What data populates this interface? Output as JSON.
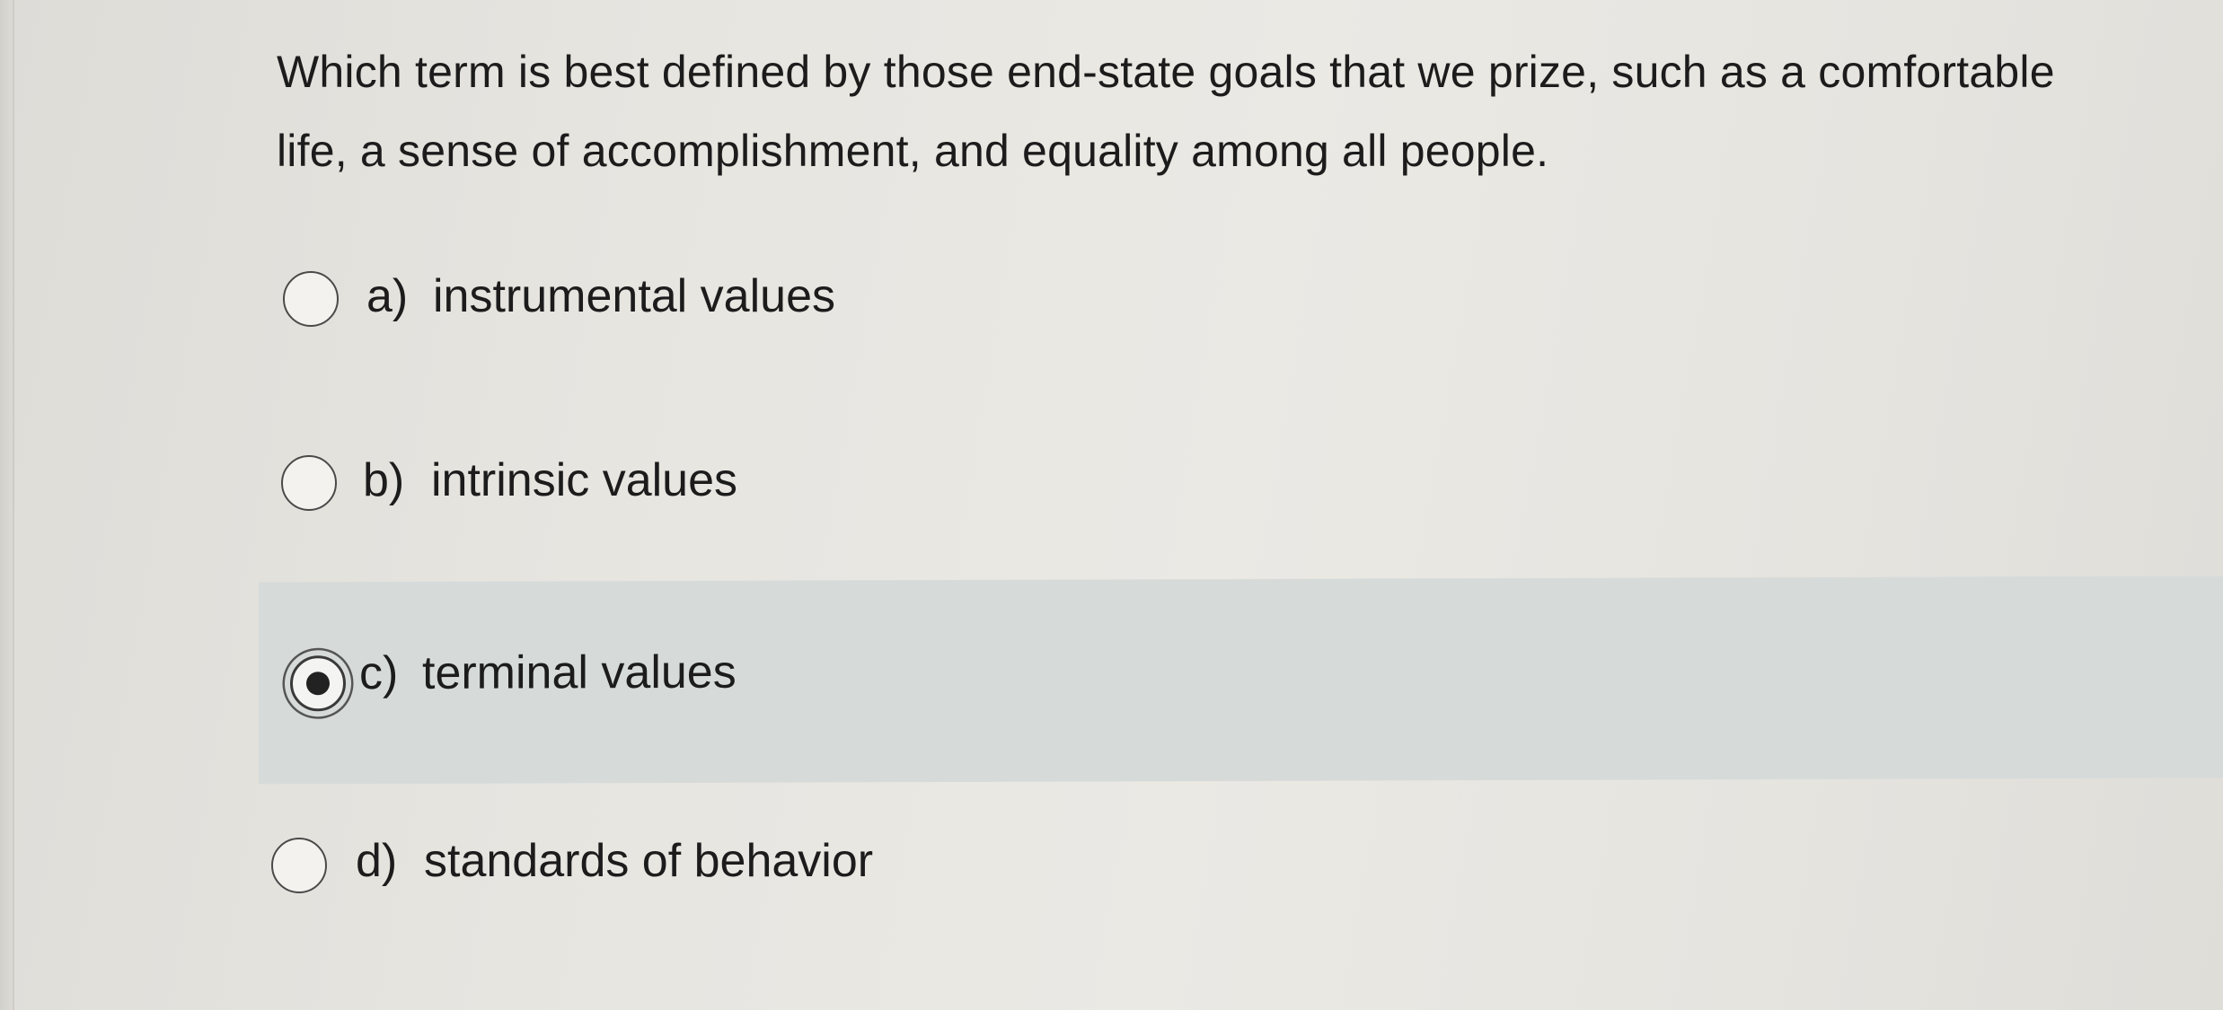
{
  "question": {
    "text": "Which term is best defined by those end-state goals that we prize, such as a comfortable life, a sense of accomplishment, and equality among all people."
  },
  "options": [
    {
      "letter": "a)",
      "text": "instrumental values",
      "selected": false
    },
    {
      "letter": "b)",
      "text": "intrinsic values",
      "selected": false
    },
    {
      "letter": "c)",
      "text": "terminal values",
      "selected": true
    },
    {
      "letter": "d)",
      "text": "standards of behavior",
      "selected": false
    }
  ],
  "colors": {
    "selected_highlight": "#d6dbda",
    "text": "#1c1c1c",
    "background": "#e7e5e0"
  }
}
